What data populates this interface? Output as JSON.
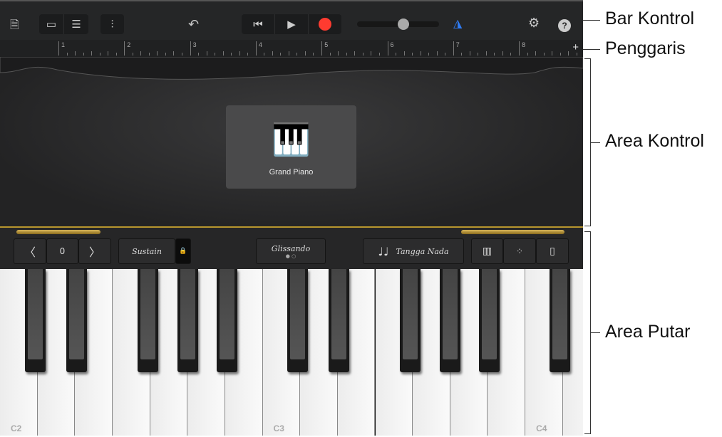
{
  "control_bar": {
    "transport": {
      "rewind": "go-to-beginning",
      "play": "play",
      "record": "record"
    },
    "record_color": "#ff3b30",
    "metronome_color": "#2f7cf6",
    "master_volume": 0.5
  },
  "ruler": {
    "bars": [
      "1",
      "2",
      "3",
      "4",
      "5",
      "6",
      "7",
      "8"
    ],
    "add": "+"
  },
  "instrument": {
    "name": "Grand Piano"
  },
  "controls": {
    "octave_value": "0",
    "sustain": "Sustain",
    "glissando": "Glissando",
    "scale": "Tangga Nada"
  },
  "keyboard": {
    "labels": {
      "C2": "C2",
      "C3": "C3",
      "C4": "C4"
    }
  },
  "annotations": [
    "Bar Kontrol",
    "Penggaris",
    "Area Kontrol",
    "Area Putar"
  ]
}
